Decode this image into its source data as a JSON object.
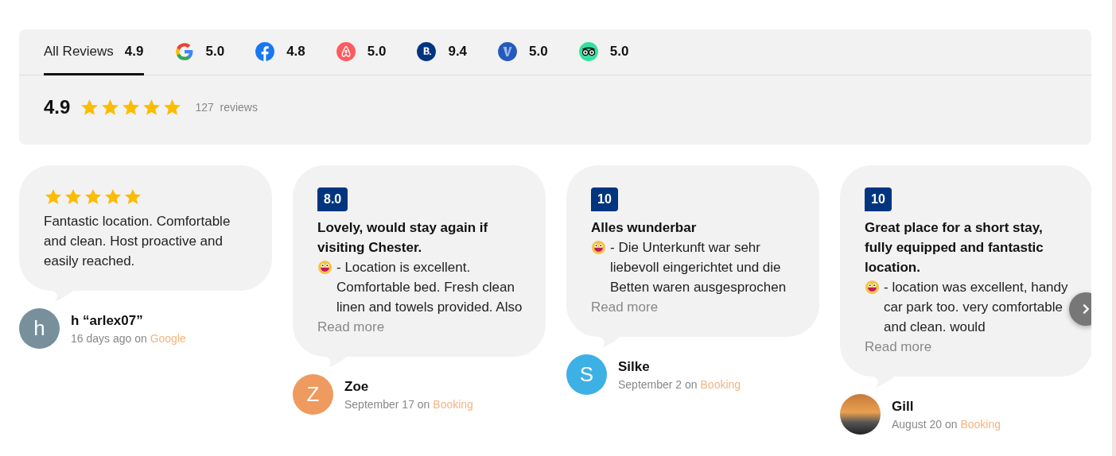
{
  "tabs": [
    {
      "kind": "all",
      "label": "All Reviews",
      "score": "4.9",
      "selected": true
    },
    {
      "kind": "google",
      "score": "5.0",
      "selected": false
    },
    {
      "kind": "facebook",
      "score": "4.8",
      "selected": false
    },
    {
      "kind": "airbnb",
      "score": "5.0",
      "selected": false
    },
    {
      "kind": "booking",
      "score": "9.4",
      "selected": false
    },
    {
      "kind": "vrbo",
      "score": "5.0",
      "selected": false
    },
    {
      "kind": "tripadvisor",
      "score": "5.0",
      "selected": false
    }
  ],
  "summary": {
    "rating": "4.9",
    "stars": 5,
    "count": "127",
    "count_label": "reviews"
  },
  "reviews": [
    {
      "kind": "stars",
      "stars": 5,
      "text": "Fantastic location. Comfortable and clean. Host proactive and easily reached.",
      "author": "h “arlex07”",
      "avatar": {
        "kind": "letter",
        "letter": "h",
        "color": "#78909c"
      },
      "date": "16 days ago",
      "on": "on",
      "source": "Google"
    },
    {
      "kind": "score",
      "score": "8.0",
      "title": "Lovely, would stay again if visiting Chester.",
      "emoji": true,
      "text": " - Location is excellent. Comfortable bed. Fresh clean linen and towels provided. Also",
      "more": "Read more",
      "author": "Zoe",
      "avatar": {
        "kind": "letter",
        "letter": "Z",
        "color": "#ef9a5f"
      },
      "date": "September 17",
      "on": "on",
      "source": "Booking"
    },
    {
      "kind": "score",
      "score": "10",
      "title": "Alles wunderbar",
      "emoji": true,
      "text": " - Die Unterkunft war sehr liebevoll eingerichtet und die Betten waren ausgesprochen",
      "more": "Read more",
      "author": "Silke",
      "avatar": {
        "kind": "letter",
        "letter": "S",
        "color": "#3db0e6"
      },
      "date": "September 2",
      "on": "on",
      "source": "Booking"
    },
    {
      "kind": "score",
      "score": "10",
      "title": "Great place for a short stay, fully equipped and fantastic location.",
      "emoji": true,
      "text": " - location was excellent, handy car park too. very comfortable and clean. would",
      "more": "Read more",
      "author": "Gill",
      "avatar": {
        "kind": "photo"
      },
      "date": "August 20",
      "on": "on",
      "source": "Booking"
    }
  ]
}
